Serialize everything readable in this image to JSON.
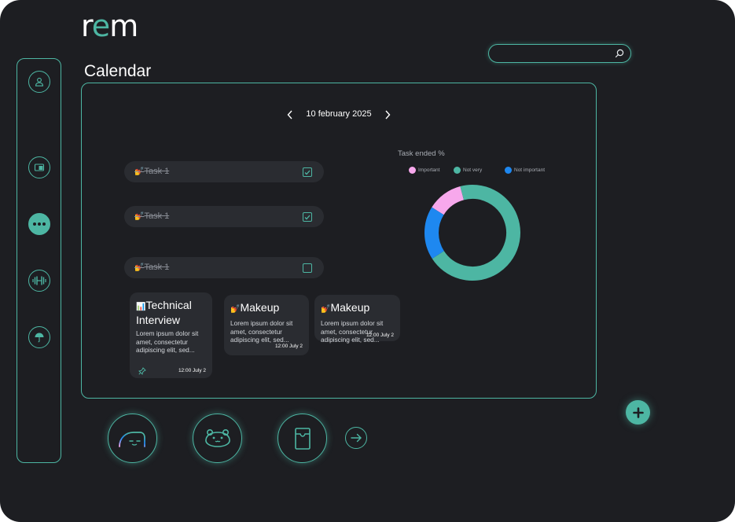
{
  "app": {
    "logo_prefix": "r",
    "logo_accent": "e",
    "logo_suffix": "m"
  },
  "search": {
    "value": "",
    "placeholder": "",
    "icon": "search-icon"
  },
  "page": {
    "title": "Calendar"
  },
  "sidebar": {
    "items": [
      {
        "icon": "user-icon",
        "active": false
      },
      {
        "icon": "card-icon",
        "active": false
      },
      {
        "icon": "more-icon",
        "active": true
      },
      {
        "icon": "dumbbell-icon",
        "active": false
      },
      {
        "icon": "umbrella-icon",
        "active": false
      }
    ]
  },
  "calendar": {
    "date": "10 february 2025",
    "tasks": [
      {
        "emoji": "💅",
        "label": "Task 1",
        "checked": true
      },
      {
        "emoji": "💅",
        "label": "Task 1",
        "checked": true
      },
      {
        "emoji": "💅",
        "label": "Task 1",
        "checked": false
      }
    ],
    "cards": [
      {
        "emoji": "📊",
        "title": "Technical Interview",
        "desc": "Lorem ipsum dolor sit amet, consectetur adipiscing elit, sed...",
        "time": "12:00 July 2",
        "pin_icon": "pin-icon"
      },
      {
        "emoji": "💅",
        "title": "Makeup",
        "desc": "Lorem ipsum dolor sit amet, consectetur adipiscing elit, sed...",
        "time": "12:00 July 2"
      },
      {
        "emoji": "💅",
        "title": "Makeup",
        "desc": "Lorem ipsum dolor sit amet, consectetur adipiscing elit, sed...",
        "time": "12:00 July 2"
      }
    ]
  },
  "chart_data": {
    "type": "pie",
    "title": "Task ended %",
    "categories": [
      "Important",
      "Not very",
      "Not important"
    ],
    "values": [
      12,
      70,
      18
    ],
    "colors": [
      "#f7a8ec",
      "#4db6a3",
      "#1e88f0"
    ],
    "legend": "top"
  },
  "bottom_bar": {
    "buttons": [
      {
        "icon": "face-gauge-icon"
      },
      {
        "icon": "bear-face-icon"
      },
      {
        "icon": "cup-icon"
      }
    ],
    "next_icon": "arrow-right-circle-icon",
    "add_icon": "plus-icon"
  },
  "colors": {
    "accent": "#4db6a3",
    "background": "#1d1e22",
    "surface": "#2a2c31"
  }
}
